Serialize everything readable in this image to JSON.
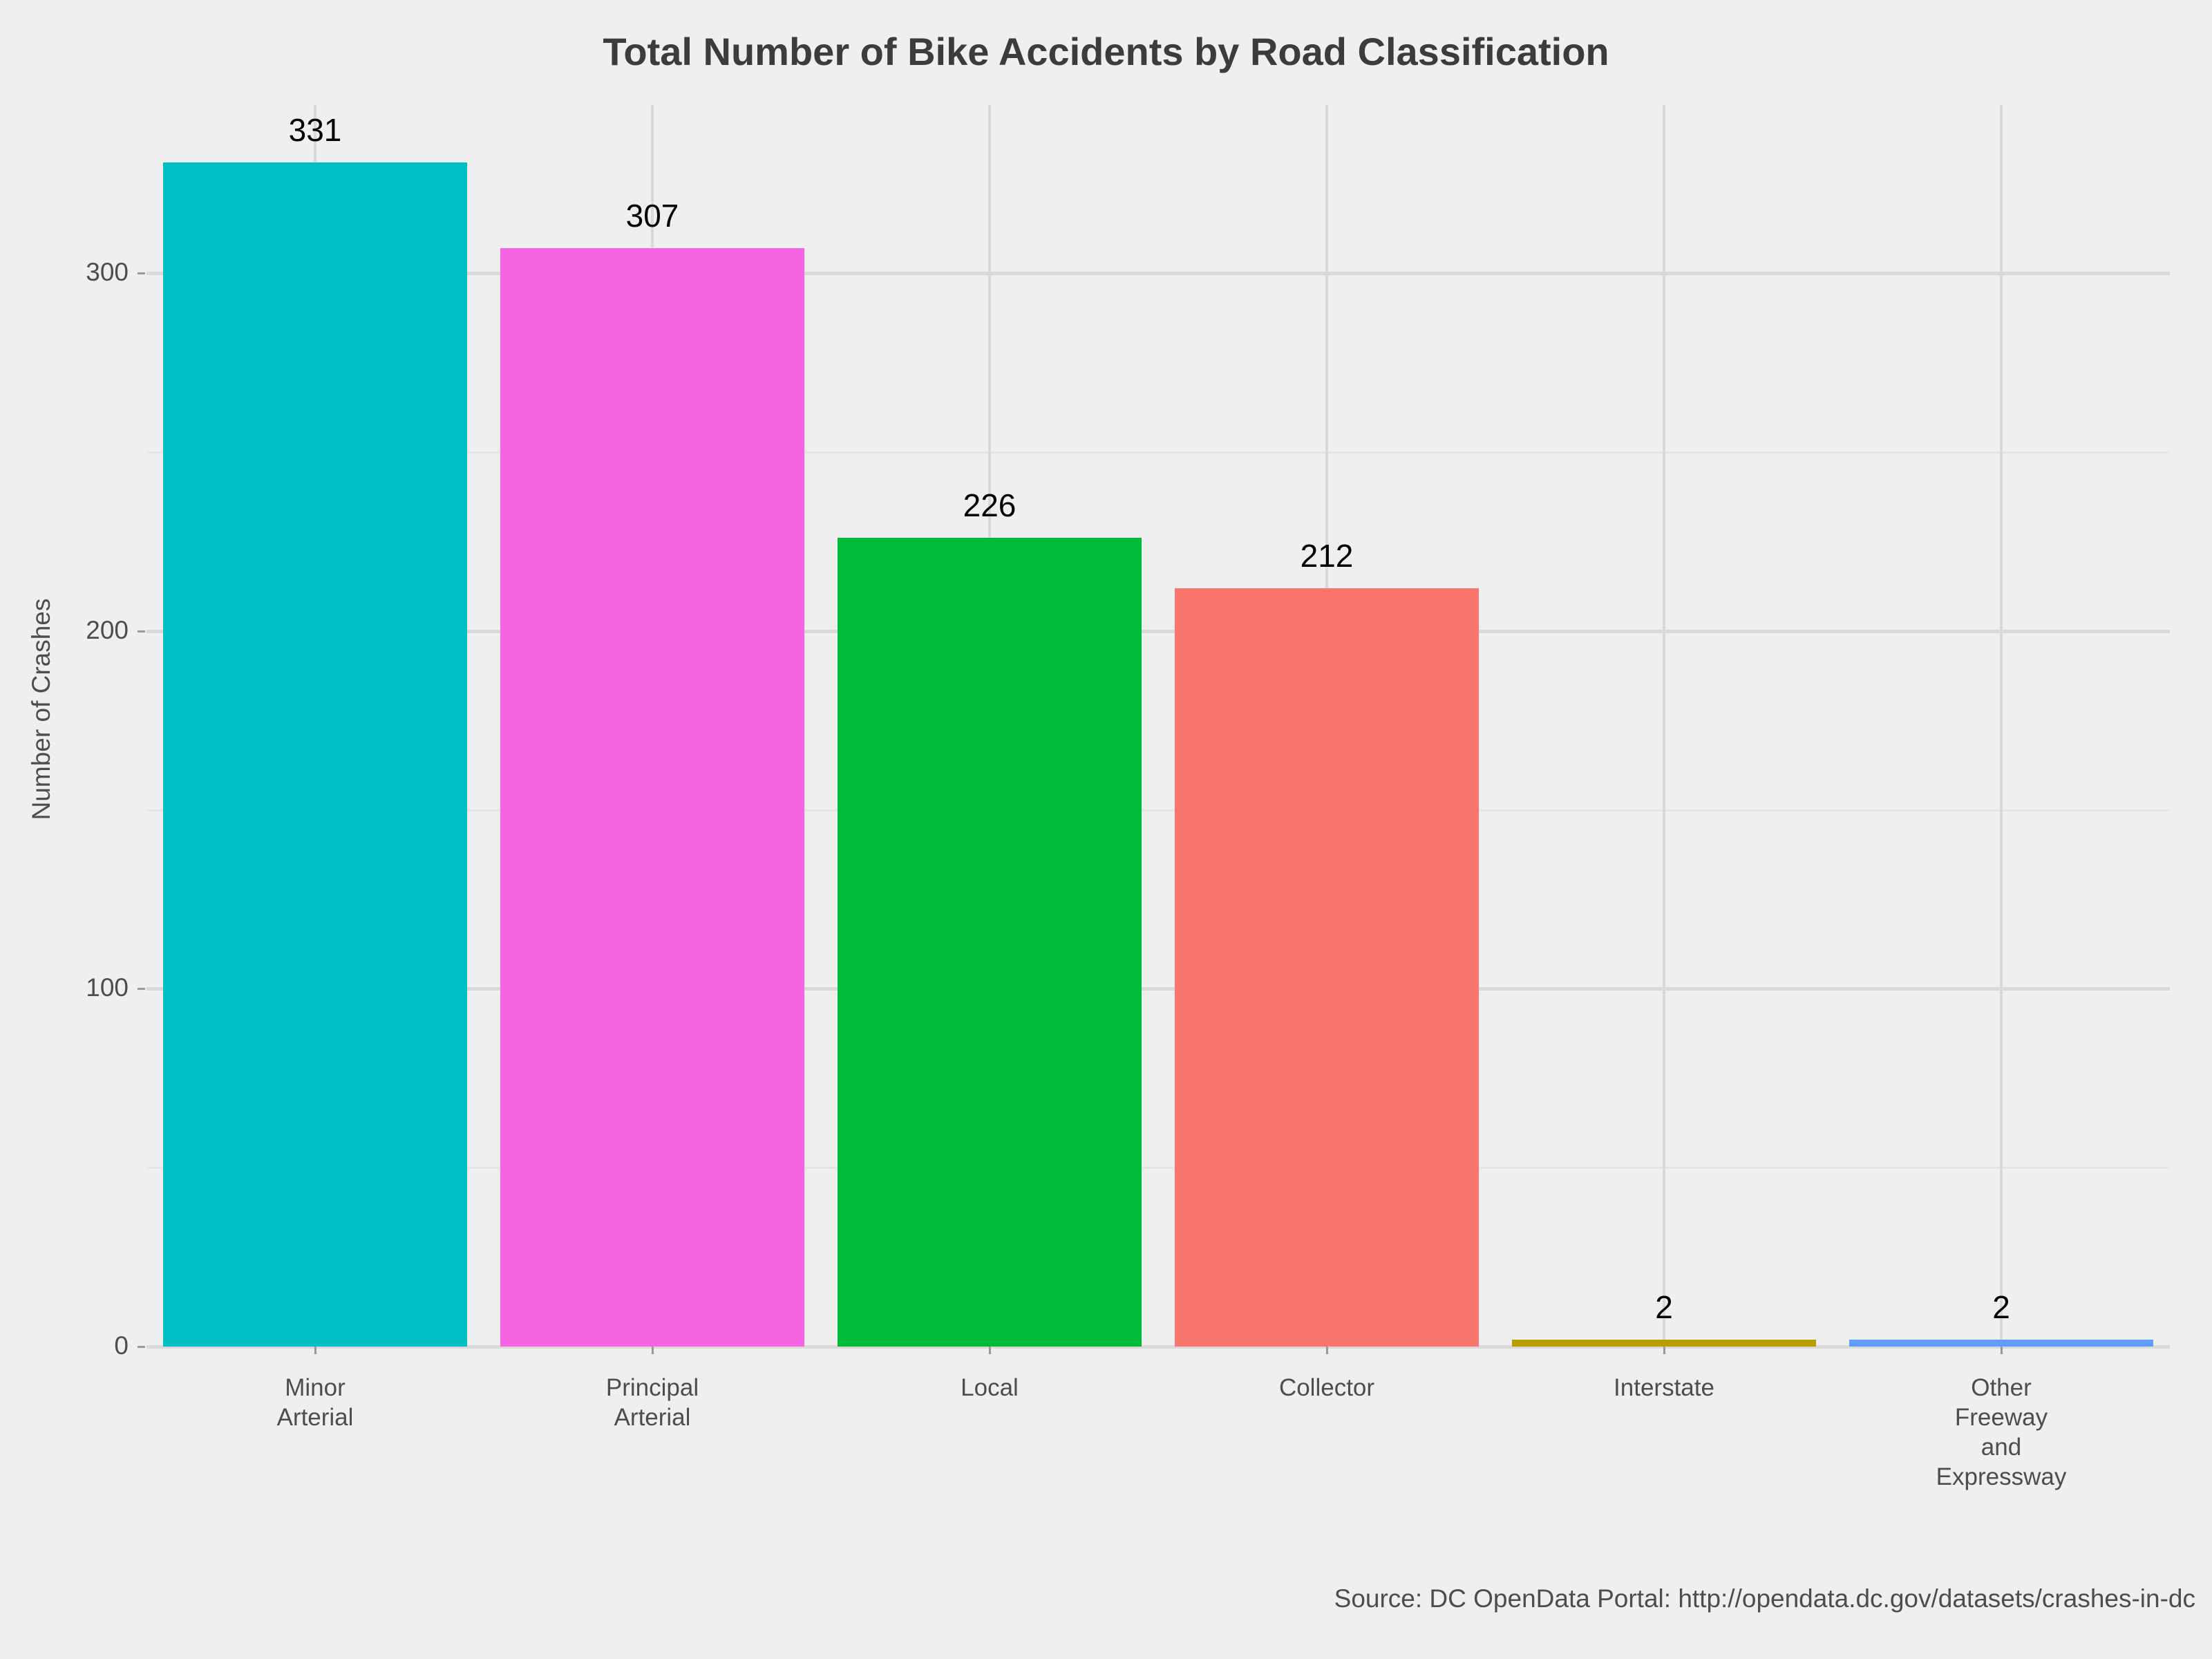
{
  "chart_data": {
    "type": "bar",
    "title": "Total Number of Bike Accidents by Road Classification",
    "xlabel": "",
    "ylabel": "Number of Crashes",
    "caption": "Source: DC OpenData Portal: http://opendata.dc.gov/datasets/crashes-in-dc",
    "categories": [
      "Minor Arterial",
      "Principal Arterial",
      "Local",
      "Collector",
      "Interstate",
      "Other Freeway and Expressway"
    ],
    "category_lines": [
      [
        "Minor",
        "Arterial"
      ],
      [
        "Principal",
        "Arterial"
      ],
      [
        "Local"
      ],
      [
        "Collector"
      ],
      [
        "Interstate"
      ],
      [
        "Other",
        "Freeway",
        "and",
        "Expressway"
      ]
    ],
    "values": [
      331,
      307,
      226,
      212,
      2,
      2
    ],
    "value_labels": [
      "331",
      "307",
      "226",
      "212",
      "2",
      "2"
    ],
    "colors": [
      "#00BFC4",
      "#F564E3",
      "#00BA38",
      "#F8766D",
      "#B79F00",
      "#619CFF"
    ],
    "ylim": [
      0,
      347
    ],
    "y_ticks": [
      0,
      100,
      200,
      300
    ],
    "y_tick_labels": [
      "0",
      "100",
      "200",
      "300"
    ],
    "grid": true,
    "legend": "none",
    "panel_background": "#EFEFEF",
    "gridline_color": "#D9D9D9",
    "text_color": "#4D4D4D",
    "title_color": "#3C3C3C"
  }
}
